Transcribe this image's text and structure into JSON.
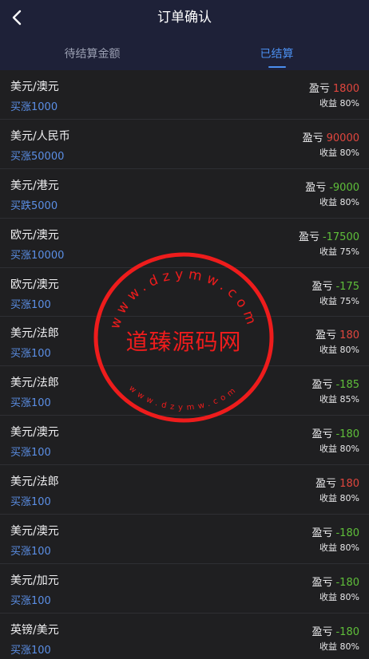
{
  "header": {
    "title": "订单确认",
    "back_icon": "chevron-left-icon"
  },
  "tabs": [
    {
      "label": "待结算金额",
      "active": false
    },
    {
      "label": "已结算",
      "active": true
    }
  ],
  "orders": [
    {
      "pair": "美元/澳元",
      "action": "买涨1000",
      "pl_label": "盈亏",
      "pl_value": "1800",
      "pl_sign": "pos",
      "return": "收益 80%"
    },
    {
      "pair": "美元/人民币",
      "action": "买涨50000",
      "pl_label": "盈亏",
      "pl_value": "90000",
      "pl_sign": "pos",
      "return": "收益 80%"
    },
    {
      "pair": "美元/港元",
      "action": "买跌5000",
      "pl_label": "盈亏",
      "pl_value": "-9000",
      "pl_sign": "neg",
      "return": "收益 80%"
    },
    {
      "pair": "欧元/澳元",
      "action": "买涨10000",
      "pl_label": "盈亏",
      "pl_value": "-17500",
      "pl_sign": "neg",
      "return": "收益 75%"
    },
    {
      "pair": "欧元/澳元",
      "action": "买涨100",
      "pl_label": "盈亏",
      "pl_value": "-175",
      "pl_sign": "neg",
      "return": "收益 75%"
    },
    {
      "pair": "美元/法郎",
      "action": "买涨100",
      "pl_label": "盈亏",
      "pl_value": "180",
      "pl_sign": "pos",
      "return": "收益 80%"
    },
    {
      "pair": "美元/法郎",
      "action": "买涨100",
      "pl_label": "盈亏",
      "pl_value": "-185",
      "pl_sign": "neg",
      "return": "收益 85%"
    },
    {
      "pair": "美元/澳元",
      "action": "买涨100",
      "pl_label": "盈亏",
      "pl_value": "-180",
      "pl_sign": "neg",
      "return": "收益 80%"
    },
    {
      "pair": "美元/法郎",
      "action": "买涨100",
      "pl_label": "盈亏",
      "pl_value": "180",
      "pl_sign": "pos",
      "return": "收益 80%"
    },
    {
      "pair": "美元/澳元",
      "action": "买涨100",
      "pl_label": "盈亏",
      "pl_value": "-180",
      "pl_sign": "neg",
      "return": "收益 80%"
    },
    {
      "pair": "美元/加元",
      "action": "买涨100",
      "pl_label": "盈亏",
      "pl_value": "-180",
      "pl_sign": "neg",
      "return": "收益 80%"
    },
    {
      "pair": "英镑/美元",
      "action": "买涨100",
      "pl_label": "盈亏",
      "pl_value": "-180",
      "pl_sign": "neg",
      "return": "收益 80%"
    }
  ],
  "watermark": {
    "name": "道臻源码网",
    "url_text": "www.dzymw.com",
    "color": "#ee1c1c"
  },
  "colors": {
    "header_bg": "#1e2138",
    "accent": "#4b8ff0",
    "profit": "#e0463e",
    "loss": "#5fbf3a",
    "row_bg": "#1f1f21"
  }
}
